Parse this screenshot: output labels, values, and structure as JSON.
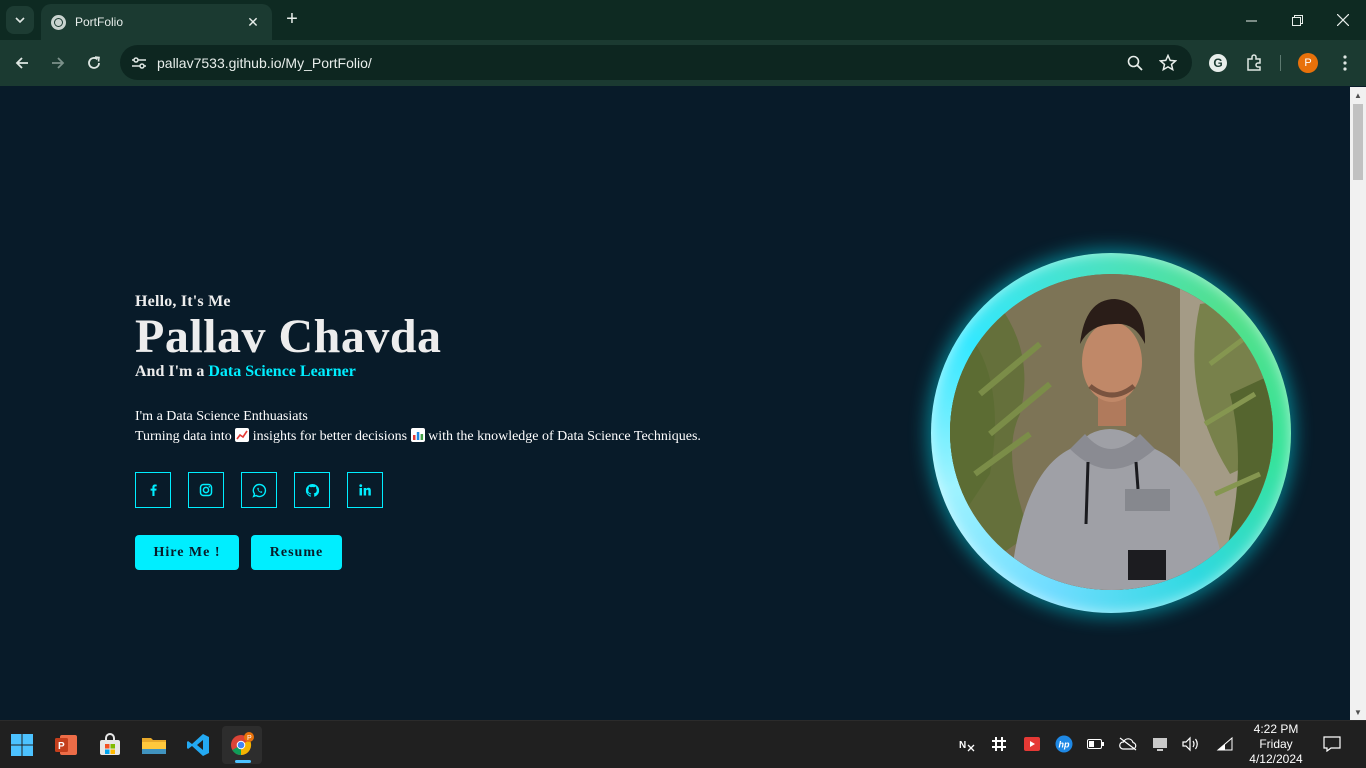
{
  "browser": {
    "tab_title": "PortFolio",
    "url_host": "pallav7533.github.io",
    "url_path": "/My_PortFolio/",
    "profile_initial": "P",
    "accent": "#e8710a"
  },
  "hero": {
    "greeting": "Hello, It's Me",
    "name": "Pallav Chavda",
    "role_prefix": "And I'm a ",
    "role_highlight": "Data Science Learner",
    "description_line1": "I'm a Data Science Enthuasiats",
    "description_line2_a": "Turning data into ",
    "description_line2_b": " insights for better decisions ",
    "description_line2_c": " with the knowledge of Data Science Techniques.",
    "accent_color": "#00eeff",
    "background_color": "#081b29"
  },
  "socials": [
    {
      "name": "facebook-icon",
      "glyph": "f"
    },
    {
      "name": "instagram-icon",
      "glyph": "ig"
    },
    {
      "name": "whatsapp-icon",
      "glyph": "wa"
    },
    {
      "name": "github-icon",
      "glyph": "gh"
    },
    {
      "name": "linkedin-icon",
      "glyph": "in"
    }
  ],
  "buttons": {
    "hire": "Hire Me !",
    "resume": "Resume"
  },
  "taskbar": {
    "time": "4:22 PM",
    "day": "Friday",
    "date": "4/12/2024",
    "apps": [
      "start-icon",
      "powerpoint-icon",
      "store-icon",
      "file-explorer-icon",
      "vscode-icon",
      "chrome-icon"
    ]
  }
}
